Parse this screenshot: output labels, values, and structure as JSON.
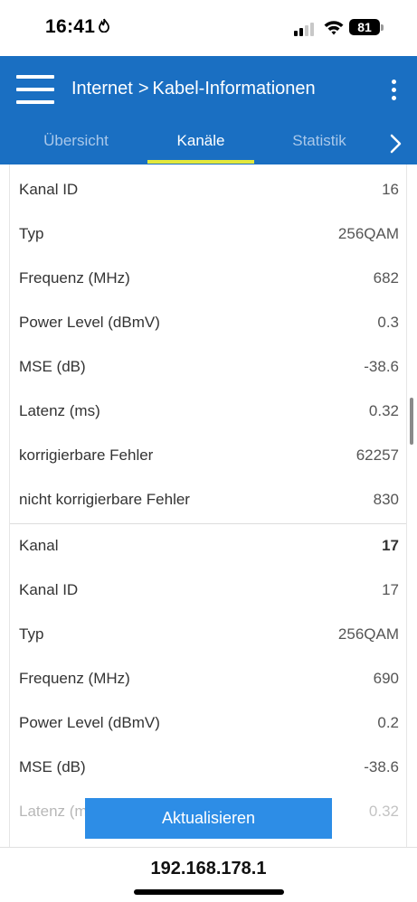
{
  "status_bar": {
    "time": "16:41",
    "time_icon": "flame-icon",
    "battery_percent": "81",
    "signal_bars_active": 2,
    "signal_bars_total": 4
  },
  "header": {
    "breadcrumb_parent": "Internet",
    "breadcrumb_separator": ">",
    "breadcrumb_current": "Kabel-Informationen",
    "accent_color": "#1a6fc2"
  },
  "tabs": [
    {
      "label": "Übersicht",
      "active": false
    },
    {
      "label": "Kanäle",
      "active": true
    },
    {
      "label": "Statistik",
      "active": false
    }
  ],
  "rows": [
    {
      "label": "Kanal ID",
      "value": "16"
    },
    {
      "label": "Typ",
      "value": "256QAM"
    },
    {
      "label": "Frequenz (MHz)",
      "value": "682"
    },
    {
      "label": "Power Level (dBmV)",
      "value": "0.3"
    },
    {
      "label": "MSE (dB)",
      "value": "-38.6"
    },
    {
      "label": "Latenz (ms)",
      "value": "0.32"
    },
    {
      "label": "korrigierbare Fehler",
      "value": "62257"
    },
    {
      "label": "nicht korrigierbare Fehler",
      "value": "830"
    },
    {
      "label": "Kanal",
      "value": "17"
    },
    {
      "label": "Kanal ID",
      "value": "17"
    },
    {
      "label": "Typ",
      "value": "256QAM"
    },
    {
      "label": "Frequenz (MHz)",
      "value": "690"
    },
    {
      "label": "Power Level (dBmV)",
      "value": "0.2"
    },
    {
      "label": "MSE (dB)",
      "value": "-38.6"
    },
    {
      "label": "Latenz (ms)",
      "value": "0.32"
    }
  ],
  "refresh_button": {
    "label": "Aktualisieren"
  },
  "browser": {
    "url": "192.168.178.1"
  }
}
